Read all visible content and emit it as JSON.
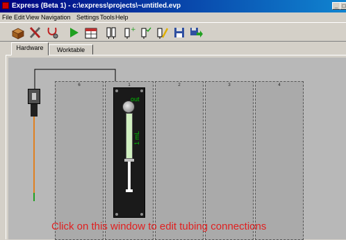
{
  "window": {
    "title": "Express (Beta 1) - c:\\express\\projects\\~untitled.evp",
    "minimize_glyph": "_",
    "close_glyph": "□"
  },
  "menu": [
    "File",
    "Edit",
    "View",
    "Navigation",
    "Settings",
    "Tools",
    "Help"
  ],
  "toolbar": {
    "icons": [
      "box-icon",
      "tools-icon",
      "stethoscope-icon",
      "play-icon",
      "calendar-icon",
      "syringe-bank-icon",
      "syringe-add-icon",
      "syringe-check-icon",
      "syringe-edit-icon",
      "save-icon",
      "export-icon"
    ],
    "colors": {
      "play": "#20a020",
      "save": "#3050a0"
    }
  },
  "tabs": {
    "items": [
      "Hardware",
      "Worktable"
    ],
    "active": "Hardware"
  },
  "worktable": {
    "columns": [
      "6",
      "1",
      "2",
      "3",
      "4"
    ],
    "syringe": {
      "port_label": "out",
      "volume_label": "1 mL",
      "label_color": "#00c000"
    }
  },
  "hint": "Click on this window to edit tubing connections"
}
